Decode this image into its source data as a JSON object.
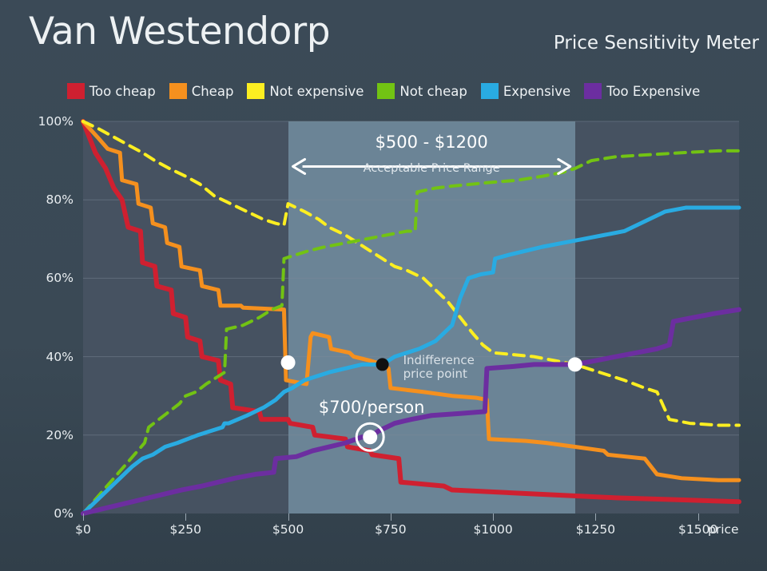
{
  "header": {
    "title": "Van Westendorp",
    "subtitle": "Price Sensitivity Meter"
  },
  "legend": {
    "items": [
      {
        "label": "Too cheap",
        "color": "#cf2030"
      },
      {
        "label": "Cheap",
        "color": "#f5901e"
      },
      {
        "label": "Not expensive",
        "color": "#fcee21"
      },
      {
        "label": "Not cheap",
        "color": "#72c313"
      },
      {
        "label": "Expensive",
        "color": "#29abe2"
      },
      {
        "label": "Too Expensive",
        "color": "#6c2ea0"
      }
    ]
  },
  "colors": {
    "page_background": "#3a4955",
    "plot_background": "#465261",
    "highlight_band": "#6b8496",
    "gridline": "#7e8b99",
    "text": "#eef2f4",
    "annotation_white": "#ffffff",
    "marker_black": "#111111"
  },
  "annotations": {
    "range_title": "$500 - $1200",
    "range_subtitle": "Acceptable Price Range",
    "range_start": 500,
    "range_end": 1200,
    "indifference_label": "Indifference\nprice point",
    "indifference_x": 730,
    "indifference_y": 38,
    "optimal_label": "$700/person",
    "optimal_x": 700,
    "optimal_y": 19.5,
    "marginal_cheapness_x": 500,
    "marginal_cheapness_y": 38.5,
    "marginal_expensiveness_x": 1200,
    "marginal_expensiveness_y": 38
  },
  "chart_data": {
    "type": "line",
    "title": "Van Westendorp",
    "subtitle": "Price Sensitivity Meter",
    "xlabel": "price",
    "ylabel": "",
    "xlim": [
      0,
      1600
    ],
    "ylim": [
      0,
      100
    ],
    "grid": true,
    "legend_position": "top-center",
    "x_ticks": [
      0,
      250,
      500,
      750,
      1000,
      1250,
      1500
    ],
    "x_tick_labels": [
      "$0",
      "$250",
      "$500",
      "$750",
      "$1000",
      "$1250",
      "$1500"
    ],
    "y_ticks": [
      0,
      20,
      40,
      60,
      80,
      100
    ],
    "y_tick_labels": [
      "0%",
      "20%",
      "40%",
      "60%",
      "80%",
      "100%"
    ],
    "series": [
      {
        "name": "Too cheap",
        "color": "#cf2030",
        "dash": false,
        "width": 6,
        "points": [
          [
            0,
            100
          ],
          [
            30,
            92
          ],
          [
            55,
            88
          ],
          [
            75,
            83
          ],
          [
            95,
            80
          ],
          [
            110,
            73
          ],
          [
            140,
            72
          ],
          [
            145,
            64
          ],
          [
            175,
            63
          ],
          [
            180,
            58
          ],
          [
            215,
            57
          ],
          [
            220,
            51
          ],
          [
            250,
            50
          ],
          [
            255,
            45
          ],
          [
            285,
            44
          ],
          [
            290,
            40
          ],
          [
            330,
            39
          ],
          [
            335,
            34
          ],
          [
            360,
            33
          ],
          [
            365,
            27
          ],
          [
            430,
            26
          ],
          [
            435,
            24
          ],
          [
            500,
            24
          ],
          [
            505,
            23
          ],
          [
            560,
            22
          ],
          [
            565,
            20
          ],
          [
            640,
            19
          ],
          [
            645,
            17
          ],
          [
            700,
            16
          ],
          [
            705,
            15
          ],
          [
            770,
            14
          ],
          [
            775,
            8
          ],
          [
            880,
            7
          ],
          [
            900,
            6
          ],
          [
            1100,
            5
          ],
          [
            1300,
            4
          ],
          [
            1450,
            3.5
          ],
          [
            1600,
            3
          ]
        ]
      },
      {
        "name": "Cheap",
        "color": "#f5901e",
        "dash": false,
        "width": 5,
        "points": [
          [
            0,
            100
          ],
          [
            35,
            96
          ],
          [
            60,
            93
          ],
          [
            90,
            92
          ],
          [
            95,
            85
          ],
          [
            130,
            84
          ],
          [
            135,
            79
          ],
          [
            165,
            78
          ],
          [
            170,
            74
          ],
          [
            200,
            73
          ],
          [
            205,
            69
          ],
          [
            235,
            68
          ],
          [
            240,
            63
          ],
          [
            285,
            62
          ],
          [
            290,
            58
          ],
          [
            330,
            57
          ],
          [
            335,
            53
          ],
          [
            385,
            53
          ],
          [
            390,
            52.5
          ],
          [
            490,
            52
          ],
          [
            495,
            34
          ],
          [
            545,
            33
          ],
          [
            555,
            45
          ],
          [
            560,
            46
          ],
          [
            600,
            45
          ],
          [
            605,
            42
          ],
          [
            650,
            41
          ],
          [
            660,
            40
          ],
          [
            700,
            39
          ],
          [
            730,
            38
          ],
          [
            745,
            37
          ],
          [
            750,
            32
          ],
          [
            830,
            31
          ],
          [
            900,
            30
          ],
          [
            960,
            29.5
          ],
          [
            985,
            29
          ],
          [
            990,
            19
          ],
          [
            1080,
            18.5
          ],
          [
            1130,
            18
          ],
          [
            1200,
            17
          ],
          [
            1270,
            16
          ],
          [
            1280,
            15
          ],
          [
            1370,
            14
          ],
          [
            1400,
            10
          ],
          [
            1460,
            9
          ],
          [
            1550,
            8.5
          ],
          [
            1600,
            8.5
          ]
        ]
      },
      {
        "name": "Not expensive",
        "color": "#fcee21",
        "dash": true,
        "width": 4,
        "points": [
          [
            0,
            100
          ],
          [
            40,
            98
          ],
          [
            75,
            96
          ],
          [
            110,
            94
          ],
          [
            145,
            92
          ],
          [
            175,
            90
          ],
          [
            210,
            88
          ],
          [
            250,
            86
          ],
          [
            285,
            84
          ],
          [
            320,
            81
          ],
          [
            360,
            79
          ],
          [
            400,
            77
          ],
          [
            440,
            75
          ],
          [
            470,
            74
          ],
          [
            490,
            73.5
          ],
          [
            500,
            79
          ],
          [
            540,
            77
          ],
          [
            575,
            75
          ],
          [
            600,
            73
          ],
          [
            640,
            71
          ],
          [
            670,
            69
          ],
          [
            700,
            67
          ],
          [
            730,
            65
          ],
          [
            760,
            63
          ],
          [
            790,
            62
          ],
          [
            830,
            60
          ],
          [
            860,
            57
          ],
          [
            890,
            54
          ],
          [
            920,
            50
          ],
          [
            950,
            46
          ],
          [
            975,
            43
          ],
          [
            1000,
            41
          ],
          [
            1050,
            40.5
          ],
          [
            1100,
            40
          ],
          [
            1150,
            39
          ],
          [
            1200,
            38
          ],
          [
            1260,
            36
          ],
          [
            1320,
            34
          ],
          [
            1370,
            32
          ],
          [
            1400,
            31
          ],
          [
            1430,
            24
          ],
          [
            1480,
            23
          ],
          [
            1550,
            22.5
          ],
          [
            1600,
            22.5
          ]
        ]
      },
      {
        "name": "Not cheap",
        "color": "#72c313",
        "dash": true,
        "width": 4,
        "points": [
          [
            0,
            0
          ],
          [
            25,
            3
          ],
          [
            50,
            6
          ],
          [
            75,
            9
          ],
          [
            100,
            12
          ],
          [
            125,
            15
          ],
          [
            150,
            18
          ],
          [
            160,
            22
          ],
          [
            185,
            24
          ],
          [
            210,
            26
          ],
          [
            235,
            28
          ],
          [
            250,
            30
          ],
          [
            275,
            31
          ],
          [
            300,
            33
          ],
          [
            330,
            35
          ],
          [
            345,
            36
          ],
          [
            350,
            47
          ],
          [
            390,
            48
          ],
          [
            430,
            50
          ],
          [
            460,
            52
          ],
          [
            485,
            53
          ],
          [
            490,
            65
          ],
          [
            520,
            66
          ],
          [
            550,
            67
          ],
          [
            590,
            68
          ],
          [
            640,
            69
          ],
          [
            690,
            70
          ],
          [
            740,
            71
          ],
          [
            790,
            72
          ],
          [
            810,
            72
          ],
          [
            815,
            82
          ],
          [
            860,
            83
          ],
          [
            900,
            83.5
          ],
          [
            950,
            84
          ],
          [
            1000,
            84.5
          ],
          [
            1060,
            85
          ],
          [
            1120,
            86
          ],
          [
            1170,
            87
          ],
          [
            1200,
            88
          ],
          [
            1240,
            90
          ],
          [
            1300,
            91
          ],
          [
            1380,
            91.5
          ],
          [
            1460,
            92
          ],
          [
            1550,
            92.5
          ],
          [
            1600,
            92.5
          ]
        ]
      },
      {
        "name": "Expensive",
        "color": "#29abe2",
        "dash": false,
        "width": 5,
        "points": [
          [
            0,
            0
          ],
          [
            30,
            3
          ],
          [
            60,
            6
          ],
          [
            90,
            9
          ],
          [
            120,
            12
          ],
          [
            145,
            14
          ],
          [
            170,
            15
          ],
          [
            200,
            17
          ],
          [
            230,
            18
          ],
          [
            255,
            19
          ],
          [
            280,
            20
          ],
          [
            310,
            21
          ],
          [
            340,
            22
          ],
          [
            345,
            23
          ],
          [
            355,
            23
          ],
          [
            400,
            25
          ],
          [
            440,
            27
          ],
          [
            470,
            29
          ],
          [
            490,
            31
          ],
          [
            510,
            32
          ],
          [
            540,
            34
          ],
          [
            570,
            35
          ],
          [
            600,
            36
          ],
          [
            640,
            37
          ],
          [
            680,
            38
          ],
          [
            730,
            38
          ],
          [
            760,
            40
          ],
          [
            790,
            41
          ],
          [
            820,
            42
          ],
          [
            860,
            44
          ],
          [
            900,
            48
          ],
          [
            920,
            55
          ],
          [
            940,
            60
          ],
          [
            970,
            61
          ],
          [
            1000,
            61.5
          ],
          [
            1005,
            65
          ],
          [
            1040,
            66
          ],
          [
            1080,
            67
          ],
          [
            1120,
            68
          ],
          [
            1170,
            69
          ],
          [
            1220,
            70
          ],
          [
            1270,
            71
          ],
          [
            1320,
            72
          ],
          [
            1380,
            75
          ],
          [
            1420,
            77
          ],
          [
            1470,
            78
          ],
          [
            1550,
            78
          ],
          [
            1600,
            78
          ]
        ]
      },
      {
        "name": "Too Expensive",
        "color": "#6c2ea0",
        "dash": false,
        "width": 6,
        "points": [
          [
            0,
            0
          ],
          [
            40,
            1
          ],
          [
            80,
            2
          ],
          [
            120,
            3
          ],
          [
            160,
            4
          ],
          [
            200,
            5
          ],
          [
            240,
            6
          ],
          [
            290,
            7
          ],
          [
            330,
            8
          ],
          [
            370,
            9
          ],
          [
            420,
            10
          ],
          [
            465,
            10.5
          ],
          [
            470,
            14
          ],
          [
            520,
            14.5
          ],
          [
            560,
            16
          ],
          [
            600,
            17
          ],
          [
            640,
            18
          ],
          [
            680,
            19.5
          ],
          [
            700,
            19.5
          ],
          [
            720,
            21
          ],
          [
            760,
            23
          ],
          [
            800,
            24
          ],
          [
            850,
            25
          ],
          [
            920,
            25.5
          ],
          [
            980,
            26
          ],
          [
            985,
            37
          ],
          [
            1050,
            37.5
          ],
          [
            1100,
            38
          ],
          [
            1160,
            38
          ],
          [
            1200,
            38
          ],
          [
            1250,
            39
          ],
          [
            1300,
            40
          ],
          [
            1350,
            41
          ],
          [
            1400,
            42
          ],
          [
            1430,
            43
          ],
          [
            1440,
            49
          ],
          [
            1490,
            50
          ],
          [
            1540,
            51
          ],
          [
            1600,
            52
          ]
        ]
      }
    ]
  }
}
